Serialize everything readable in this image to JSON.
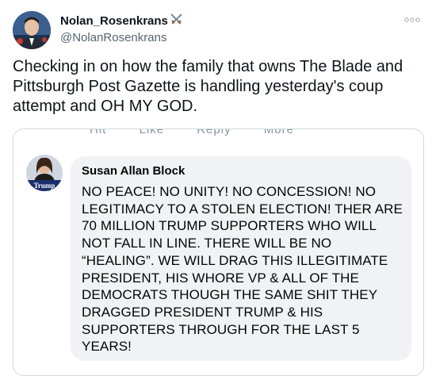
{
  "tweet": {
    "author": {
      "name": "Nolan_Rosenkrans",
      "handle": "@NolanRosenkrans",
      "name_emoji": "crossed-swords-icon"
    },
    "text": "Checking in on how the family that owns The Blade and Pittsburgh Post Gazette is handling yesterday's coup attempt and OH MY GOD.",
    "menu_icon": "more-options-icon"
  },
  "embedded_image": {
    "cropped_actions": [
      "Hit",
      "Like",
      "Reply",
      "More"
    ],
    "comment": {
      "author": "Susan Allan Block",
      "avatar_text": "Trump",
      "text": "NO PEACE! NO UNITY! NO CONCESSION! NO LEGITIMACY TO A STOLEN ELECTION! THER ARE 70 MILLION TRUMP SUPPORTERS WHO WILL NOT FALL IN LINE. THERE WILL BE NO “HEALING”. WE WILL DRAG THIS ILLEGITIMATE PRESIDENT, HIS WHORE VP & ALL OF THE DEMOCRATS THOUGH THE SAME SHIT THEY DRAGGED PRESIDENT TRUMP & HIS SUPPORTERS THROUGH FOR THE LAST 5 YEARS!"
    }
  },
  "colors": {
    "text_primary": "#0f1419",
    "text_secondary": "#536471",
    "border": "#cfd9de",
    "comment_bubble": "#f0f2f5"
  }
}
